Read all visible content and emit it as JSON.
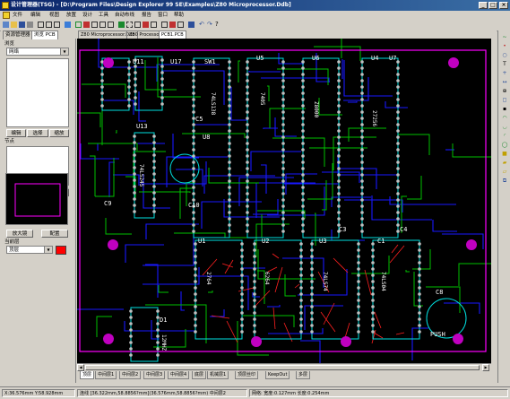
{
  "app": {
    "title": "设计管理器(TSG) - [D:\\Program Files\\Design Explorer 99 SE\\Examples\\Z80 Microprocessor.Ddb]",
    "title_controls": [
      "_",
      "□",
      "×"
    ]
  },
  "menubar": {
    "items": [
      "文件",
      "编辑",
      "视图",
      "放置",
      "设计",
      "工具",
      "自动布线",
      "报告",
      "窗口",
      "帮助"
    ]
  },
  "left_panel": {
    "tabs": [
      "资源管理器",
      "浏览 PCB"
    ],
    "browse_label": "浏览",
    "browse_value": "网络",
    "btn_edit": "编辑",
    "btn_select": "选择",
    "btn_zoom": "缩放",
    "nodes_label": "节点",
    "btn_edit2": "编辑",
    "btn_select2": "选择",
    "btn_jump": "跳转",
    "btn_magnify": "放大镜",
    "btn_config": "配置",
    "current_layer_label": "当前层",
    "current_layer_value": "顶层",
    "current_layer_color": "#ff0000"
  },
  "doc_tabs": [
    "Z80 Microprocessor.Ddb",
    "Z80 Processor",
    "PCB1.PCB"
  ],
  "pcb": {
    "component_labels": [
      "U11",
      "U17",
      "SW1",
      "U5",
      "U6",
      "U4",
      "U7",
      "U13",
      "U8",
      "C5",
      "U2",
      "U3",
      "U1",
      "C3",
      "C4",
      "C1",
      "C10",
      "C9",
      "C8",
      "D1",
      "PUSH"
    ],
    "part_values": [
      "74LS138",
      "7405",
      "Z8000",
      "27256",
      "2764",
      "6264",
      "74LS74",
      "74LS04",
      "74LS245",
      "12MHZ"
    ],
    "colors": {
      "background": "#000000",
      "top_layer": "#ff0000",
      "bottom_layer": "#0000ff",
      "overlay": "#ffff00",
      "keepout": "#ff00ff",
      "board_outline": "#00ffff"
    }
  },
  "layer_tabs": [
    "顶层",
    "中间层1",
    "中间层2",
    "中间层3",
    "中间层4",
    "底层",
    "机械层1",
    "顶层丝印",
    "KeepOut",
    "多层"
  ],
  "status": {
    "coords": "X:36.576mm Y:58.928mm",
    "info": "连线 [36.322mm,58.8856?mm](36.576mm,58.8856?mm) 中间层2",
    "net": "网络: 宽度:0.127mm 长度:0.254mm"
  }
}
